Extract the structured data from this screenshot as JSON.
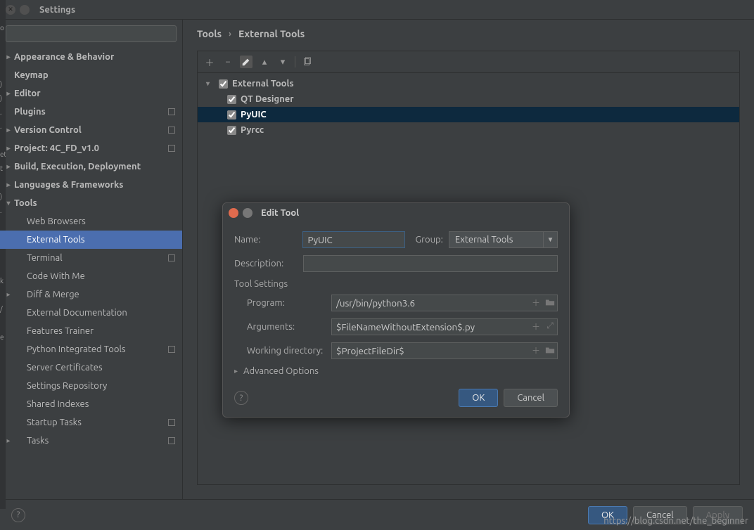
{
  "window": {
    "title": "Settings"
  },
  "search": {
    "placeholder": ""
  },
  "sidebar": {
    "items": [
      {
        "label": "Appearance & Behavior",
        "bold": true,
        "chev": "right"
      },
      {
        "label": "Keymap",
        "bold": true
      },
      {
        "label": "Editor",
        "bold": true,
        "chev": "right"
      },
      {
        "label": "Plugins",
        "bold": true,
        "proj": true
      },
      {
        "label": "Version Control",
        "bold": true,
        "chev": "right",
        "proj": true
      },
      {
        "label": "Project: 4C_FD_v1.0",
        "bold": true,
        "chev": "right",
        "proj": true
      },
      {
        "label": "Build, Execution, Deployment",
        "bold": true,
        "chev": "right"
      },
      {
        "label": "Languages & Frameworks",
        "bold": true,
        "chev": "right"
      },
      {
        "label": "Tools",
        "bold": true,
        "chev": "down"
      },
      {
        "label": "Web Browsers",
        "indent": 1
      },
      {
        "label": "External Tools",
        "indent": 1,
        "selected": true
      },
      {
        "label": "Terminal",
        "indent": 1,
        "proj": true
      },
      {
        "label": "Code With Me",
        "indent": 1
      },
      {
        "label": "Diff & Merge",
        "indent": 1,
        "chev": "right"
      },
      {
        "label": "External Documentation",
        "indent": 1
      },
      {
        "label": "Features Trainer",
        "indent": 1
      },
      {
        "label": "Python Integrated Tools",
        "indent": 1,
        "proj": true
      },
      {
        "label": "Server Certificates",
        "indent": 1
      },
      {
        "label": "Settings Repository",
        "indent": 1
      },
      {
        "label": "Shared Indexes",
        "indent": 1
      },
      {
        "label": "Startup Tasks",
        "indent": 1,
        "proj": true
      },
      {
        "label": "Tasks",
        "indent": 1,
        "chev": "right",
        "proj": true
      }
    ]
  },
  "breadcrumb": {
    "a": "Tools",
    "b": "External Tools"
  },
  "tree": {
    "root": "External Tools",
    "children": [
      {
        "label": "QT  Designer"
      },
      {
        "label": "PyUIC",
        "selected": true
      },
      {
        "label": "Pyrcc"
      }
    ]
  },
  "dialog": {
    "title": "Edit Tool",
    "name_label": "Name:",
    "name_value": "PyUIC",
    "group_label": "Group:",
    "group_value": "External Tools",
    "desc_label": "Description:",
    "desc_value": "",
    "section": "Tool Settings",
    "program_label": "Program:",
    "program_value": "/usr/bin/python3.6",
    "arguments_label": "Arguments:",
    "arguments_value": "$FileNameWithoutExtension$.py",
    "workdir_label": "Working directory:",
    "workdir_value": "$ProjectFileDir$",
    "advanced": "Advanced Options",
    "ok": "OK",
    "cancel": "Cancel"
  },
  "buttons": {
    "ok": "OK",
    "cancel": "Cancel",
    "apply": "Apply"
  },
  "watermark": "https://blog.csdn.net/the_beginner"
}
